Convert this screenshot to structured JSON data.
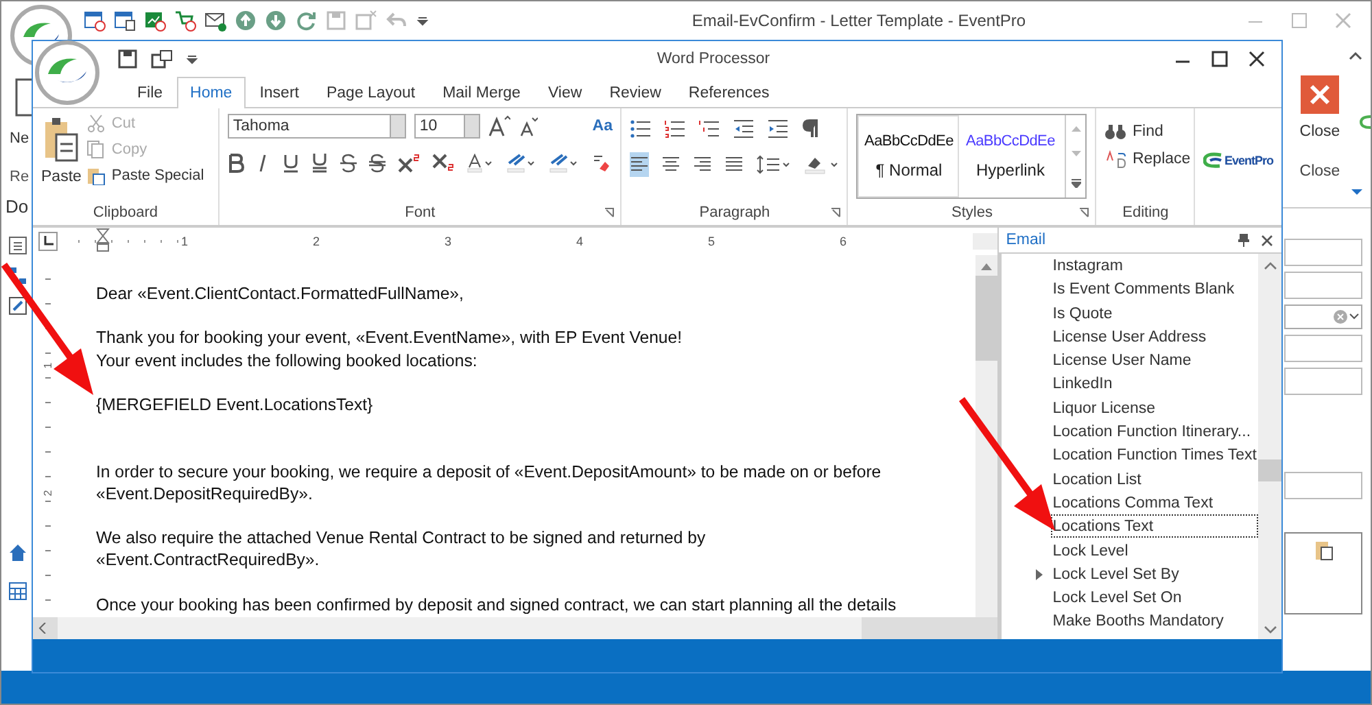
{
  "main_window": {
    "title": "Email-EvConfirm - Letter Template - EventPro"
  },
  "background_ribbon": {
    "left_labels": [
      "Ne",
      "Re",
      "Do"
    ],
    "close_button": "Close",
    "close_group": "Close"
  },
  "word_processor": {
    "title": "Word Processor",
    "tabs": [
      {
        "label": "File",
        "selected": false
      },
      {
        "label": "Home",
        "selected": true
      },
      {
        "label": "Insert",
        "selected": false
      },
      {
        "label": "Page Layout",
        "selected": false
      },
      {
        "label": "Mail Merge",
        "selected": false
      },
      {
        "label": "View",
        "selected": false
      },
      {
        "label": "Review",
        "selected": false
      },
      {
        "label": "References",
        "selected": false
      }
    ],
    "clipboard": {
      "paste": "Paste",
      "group": "Clipboard",
      "items": [
        {
          "label": "Cut",
          "kind": "cut",
          "disabled": true
        },
        {
          "label": "Copy",
          "kind": "copy",
          "disabled": true
        },
        {
          "label": "Paste Special",
          "kind": "paste",
          "disabled": false
        }
      ]
    },
    "font": {
      "name": "Tahoma",
      "size": "10",
      "case_button": "Aa",
      "group": "Font"
    },
    "paragraph": {
      "group": "Paragraph",
      "alignment": [
        {
          "kind": "left",
          "selected": true
        },
        {
          "kind": "center",
          "selected": false
        },
        {
          "kind": "right",
          "selected": false
        },
        {
          "kind": "justify",
          "selected": false
        }
      ]
    },
    "styles": {
      "group": "Styles",
      "items": [
        {
          "sample": "AaBbCcDdEe",
          "label": "¶ Normal",
          "kind": "paragraph",
          "selected": true
        },
        {
          "sample": "AaBbCcDdEe",
          "label": "Hyperlink",
          "kind": "link",
          "selected": false
        }
      ]
    },
    "editing": {
      "group": "Editing",
      "find": "Find",
      "replace": "Replace"
    },
    "logo_text": "EventPro",
    "ruler_numbers": [
      "1",
      "2",
      "3",
      "4",
      "5",
      "6"
    ],
    "vertical_ruler_numbers": [
      "1",
      "2"
    ],
    "document": {
      "paragraphs": [
        {
          "kind": "text",
          "lines": [
            "Dear «Event.ClientContact.FormattedFullName»,"
          ]
        },
        {
          "kind": "text",
          "lines": [
            "Thank you for booking your event, «Event.EventName», with EP Event Venue!",
            "Your event includes the following booked locations:"
          ]
        },
        {
          "kind": "field",
          "lines": [
            "{MERGEFIELD Event.LocationsText}"
          ]
        },
        {
          "kind": "text",
          "lines": [
            "In order to secure your booking, we require a deposit of «Event.DepositAmount» to be made on or before",
            "«Event.DepositRequiredBy»."
          ]
        },
        {
          "kind": "text",
          "lines": [
            "We also require the attached Venue Rental Contract to be signed and returned by",
            "«Event.ContractRequiredBy»."
          ]
        },
        {
          "kind": "text",
          "lines": [
            "Once your booking has been confirmed by deposit and signed contract, we can start planning all the details"
          ]
        }
      ]
    },
    "field_panel": {
      "title": "Email",
      "items": [
        {
          "label": "Instagram",
          "kind": "leaf",
          "selected": false
        },
        {
          "label": "Is Event Comments Blank",
          "kind": "leaf",
          "selected": false
        },
        {
          "label": "Is Quote",
          "kind": "leaf",
          "selected": false
        },
        {
          "label": "License User Address",
          "kind": "leaf",
          "selected": false
        },
        {
          "label": "License User Name",
          "kind": "leaf",
          "selected": false
        },
        {
          "label": "LinkedIn",
          "kind": "leaf",
          "selected": false
        },
        {
          "label": "Liquor License",
          "kind": "leaf",
          "selected": false
        },
        {
          "label": "Location Function Itinerary...",
          "kind": "leaf",
          "selected": false
        },
        {
          "label": "Location Function Times Text",
          "kind": "leaf",
          "selected": false
        },
        {
          "label": "Location List",
          "kind": "leaf",
          "selected": false
        },
        {
          "label": "Locations Comma Text",
          "kind": "leaf",
          "selected": false
        },
        {
          "label": "Locations Text",
          "kind": "leaf",
          "selected": true
        },
        {
          "label": "Lock Level",
          "kind": "leaf",
          "selected": false
        },
        {
          "label": "Lock Level Set By",
          "kind": "group",
          "selected": false
        },
        {
          "label": "Lock Level Set On",
          "kind": "leaf",
          "selected": false
        },
        {
          "label": "Make Booths Mandatory",
          "kind": "leaf",
          "selected": false
        }
      ]
    }
  }
}
